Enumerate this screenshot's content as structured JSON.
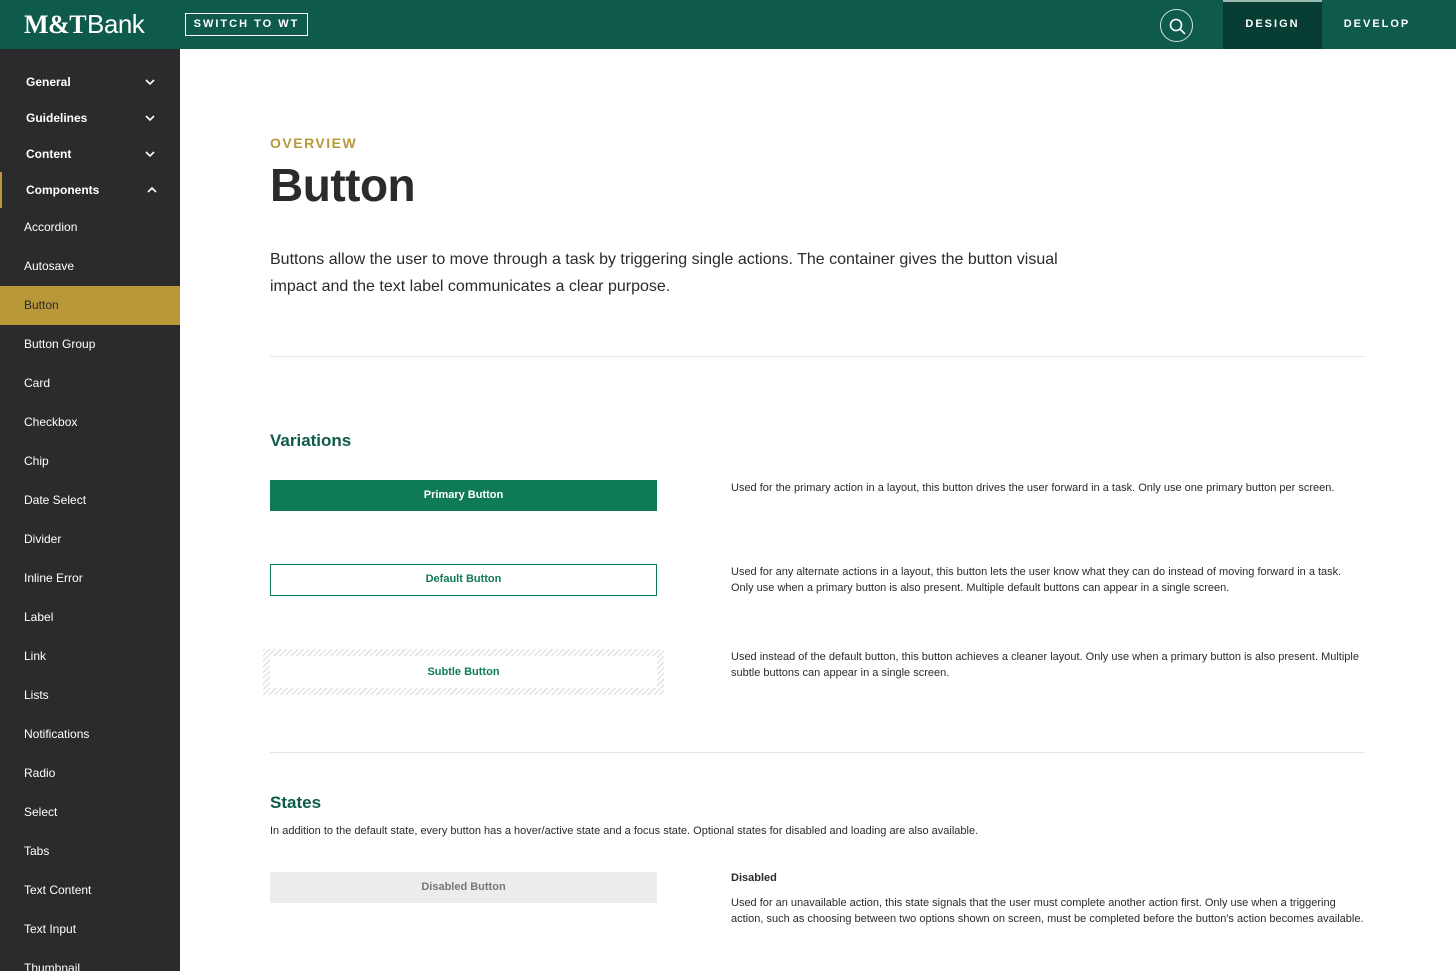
{
  "header": {
    "logo_main": "M&T",
    "logo_bank": "Bank",
    "switch_label": "SWITCH TO WT",
    "tabs": [
      {
        "label": "DESIGN",
        "active": true
      },
      {
        "label": "DEVELOP",
        "active": false
      }
    ]
  },
  "sidebar": {
    "sections": [
      {
        "label": "General",
        "expanded": false
      },
      {
        "label": "Guidelines",
        "expanded": false
      },
      {
        "label": "Content",
        "expanded": false
      },
      {
        "label": "Components",
        "expanded": true
      }
    ],
    "items": [
      {
        "label": "Accordion"
      },
      {
        "label": "Autosave"
      },
      {
        "label": "Button",
        "selected": true
      },
      {
        "label": "Button Group"
      },
      {
        "label": "Card"
      },
      {
        "label": "Checkbox"
      },
      {
        "label": "Chip"
      },
      {
        "label": "Date Select"
      },
      {
        "label": "Divider"
      },
      {
        "label": "Inline Error"
      },
      {
        "label": "Label"
      },
      {
        "label": "Link"
      },
      {
        "label": "Lists"
      },
      {
        "label": "Notifications"
      },
      {
        "label": "Radio"
      },
      {
        "label": "Select"
      },
      {
        "label": "Tabs"
      },
      {
        "label": "Text Content"
      },
      {
        "label": "Text Input"
      },
      {
        "label": "Thumbnail"
      }
    ]
  },
  "main": {
    "eyebrow": "OVERVIEW",
    "title": "Button",
    "intro": "Buttons allow the user to move through a task by triggering single actions. The container gives the button visual impact and the text label communicates a clear purpose.",
    "variations": {
      "heading": "Variations",
      "items": [
        {
          "label": "Primary Button",
          "desc": "Used for the primary action in a layout, this button drives the user forward in a task. Only use one primary button per screen."
        },
        {
          "label": "Default Button",
          "desc": "Used for any alternate actions in a layout, this button lets the user know what they can do instead of moving forward in a task. Only use when a primary button is also present. Multiple default buttons can appear in a single screen."
        },
        {
          "label": "Subtle Button",
          "desc": "Used instead of the default button, this button achieves a cleaner layout. Only use when a primary button is also present. Multiple subtle buttons can appear in a single screen."
        }
      ]
    },
    "states": {
      "heading": "States",
      "intro": "In addition to the default state, every button has a hover/active state and a focus state. Optional states for disabled and loading are also available.",
      "disabled": {
        "button_label": "Disabled Button",
        "title": "Disabled",
        "desc": "Used for an unavailable action, this state signals that the user must complete another action first. Only use when a triggering action, such as choosing between two options shown on screen, must be completed before the button's action becomes available."
      }
    }
  },
  "colors": {
    "header_bg": "#0f5b4b",
    "sidebar_bg": "#2b2b2e",
    "accent_gold": "#b89839",
    "primary_green": "#0f7a57",
    "heading_green": "#0f5b4b"
  },
  "icons": {
    "search": "search-icon",
    "chevron_down": "chevron-down-icon",
    "chevron_up": "chevron-up-icon"
  }
}
